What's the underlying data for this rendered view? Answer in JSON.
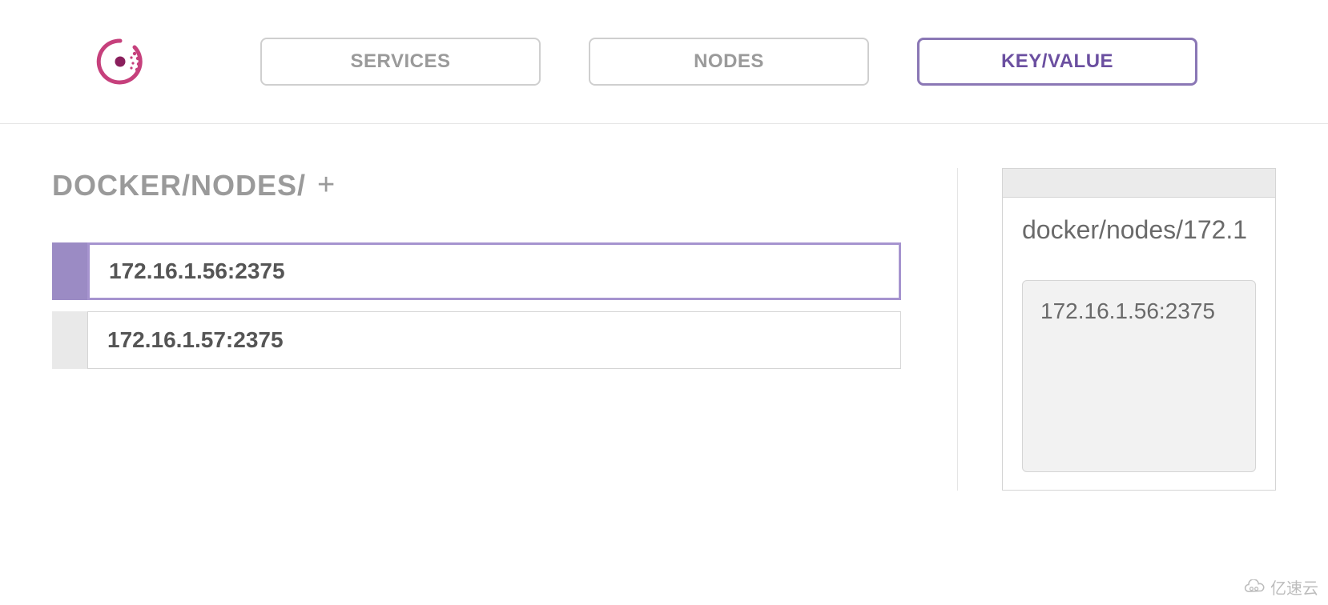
{
  "tabs": {
    "services": "SERVICES",
    "nodes": "NODES",
    "kv": "KEY/VALUE"
  },
  "breadcrumb": {
    "path": "DOCKER/NODES/",
    "add": "+"
  },
  "keys": [
    {
      "label": "172.16.1.56:2375",
      "selected": true
    },
    {
      "label": "172.16.1.57:2375",
      "selected": false
    }
  ],
  "detail": {
    "title": "docker/nodes/172.1",
    "value": "172.16.1.56:2375"
  },
  "watermark": "亿速云"
}
